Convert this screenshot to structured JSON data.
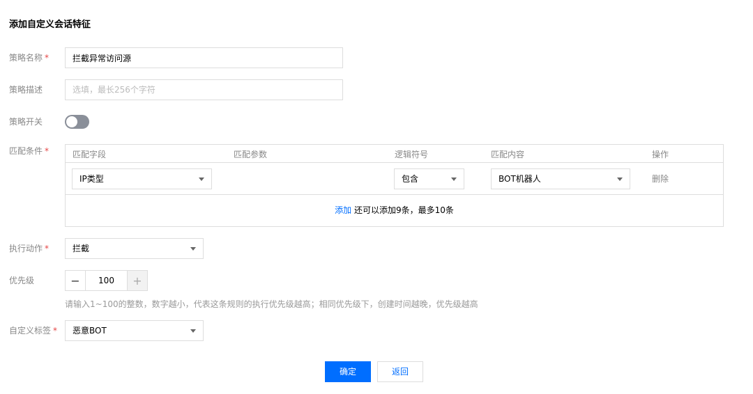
{
  "form": {
    "title": "添加自定义会话特征",
    "required_mark": "*",
    "name": {
      "label": "策略名称",
      "value": "拦截异常访问源"
    },
    "desc": {
      "label": "策略描述",
      "placeholder": "选填，最长256个字符"
    },
    "switch": {
      "label": "策略开关",
      "on": false
    },
    "conditions": {
      "label": "匹配条件",
      "headers": [
        "匹配字段",
        "匹配参数",
        "逻辑符号",
        "匹配内容",
        "操作"
      ],
      "rows": [
        {
          "field": "IP类型",
          "param": "",
          "operator": "包含",
          "content": "BOT机器人",
          "action": "删除"
        }
      ],
      "add_link": "添加",
      "add_hint": " 还可以添加9条，最多10条"
    },
    "action": {
      "label": "执行动作",
      "value": "拦截"
    },
    "priority": {
      "label": "优先级",
      "value": "100",
      "minus": "−",
      "plus": "+",
      "hint": "请输入1~100的整数，数字越小，代表这条规则的执行优先级越高；相同优先级下，创建时间越晚，优先级越高"
    },
    "tag": {
      "label": "自定义标签",
      "value": "恶意BOT"
    },
    "confirm_label": "确定",
    "back_label": "返回"
  },
  "colors": {
    "primary": "#006eff",
    "required": "#e54545",
    "border": "#dddddd",
    "label": "#888888"
  }
}
